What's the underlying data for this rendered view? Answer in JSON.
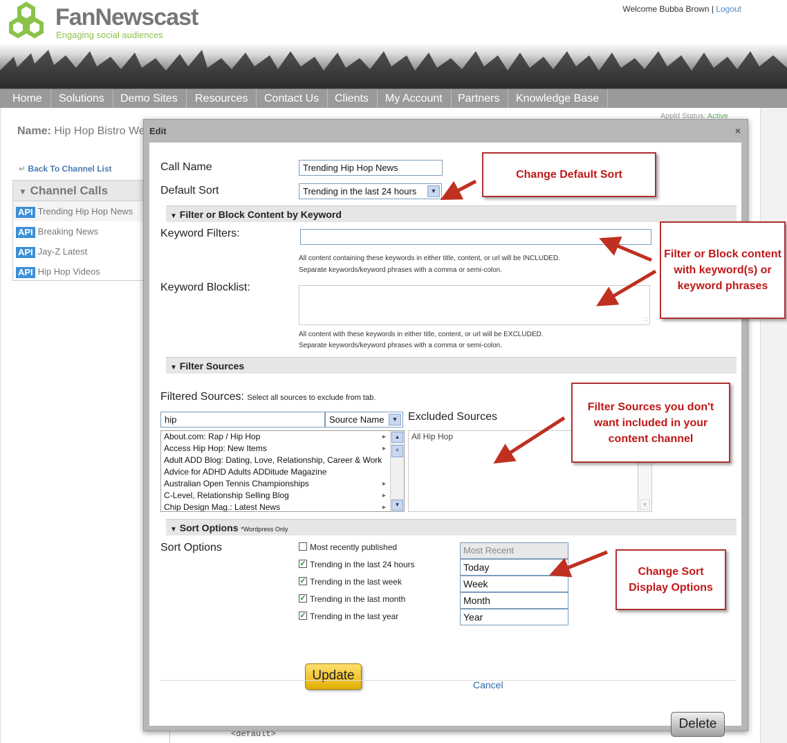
{
  "brand": {
    "name": "FanNewscast",
    "tagline": "Engaging social audiences"
  },
  "user": {
    "welcome": "Welcome Bubba Brown |",
    "logout": "Logout"
  },
  "nav": [
    "Home",
    "Solutions",
    "Demo Sites",
    "Resources",
    "Contact Us",
    "Clients",
    "My Account",
    "Partners",
    "Knowledge Base"
  ],
  "page": {
    "name_label": "Name:",
    "name_value": "Hip Hop Bistro We",
    "back_link": "Back To Channel List",
    "status_label": "Appld Status:",
    "status_value": "Active",
    "code_line": "<default>"
  },
  "channel_calls": {
    "title": "Channel Calls",
    "badge": "API",
    "items": [
      "Trending Hip Hop News",
      "Breaking News",
      "Jay-Z Latest",
      "Hip Hop Videos"
    ]
  },
  "dialog": {
    "title": "Edit",
    "close": "×",
    "call_name_label": "Call Name",
    "call_name_value": "Trending Hip Hop News",
    "default_sort_label": "Default Sort",
    "default_sort_value": "Trending in the last 24 hours",
    "section_keyword": "Filter or Block Content by Keyword",
    "keyword_filters_label": "Keyword Filters:",
    "keyword_filters_value": "",
    "keyword_filters_hint1": "All content containing these keywords in either title, content, or url will be INCLUDED.",
    "keyword_filters_hint2": "Separate keywords/keyword phrases with a comma or semi-colon.",
    "keyword_blocklist_label": "Keyword Blocklist:",
    "keyword_blocklist_hint1": "All content with these keywords in either title, content, or url will be EXCLUDED.",
    "keyword_blocklist_hint2": "Separate keywords/keyword phrases with a comma or semi-colon.",
    "section_sources": "Filter Sources",
    "filtered_sources_label": "Filtered Sources:",
    "filtered_sources_hint": "Select all sources to exclude from tab.",
    "source_search_value": "hip",
    "source_type_value": "Source Name",
    "excluded_sources_label": "Excluded Sources",
    "sources": [
      "About.com: Rap / Hip Hop",
      "Access Hip Hop: New Items",
      "Adult ADD Blog: Dating, Love, Relationship, Career & Work",
      "Advice for ADHD Adults ADDitude Magazine",
      "Australian Open Tennis Championships",
      "C-Level, Relationship Selling Blog",
      "Chip Design Mag.: Latest News"
    ],
    "excluded": [
      "All Hip Hop"
    ],
    "section_sort": "Sort Options",
    "section_sort_note": "*Wordpress Only",
    "sort_options_label": "Sort Options",
    "sort_options": [
      {
        "label": "Most recently published",
        "checked": false,
        "display": "Most Recent"
      },
      {
        "label": "Trending in the last 24 hours",
        "checked": true,
        "display": "Today"
      },
      {
        "label": "Trending in the last week",
        "checked": true,
        "display": "Week"
      },
      {
        "label": "Trending in the last month",
        "checked": true,
        "display": "Month"
      },
      {
        "label": "Trending in the last year",
        "checked": true,
        "display": "Year"
      }
    ],
    "update_label": "Update",
    "cancel_label": "Cancel",
    "delete_label": "Delete"
  },
  "callouts": {
    "default_sort": "Change Default Sort",
    "keyword": "Filter or Block content with keyword(s) or keyword phrases",
    "sources": "Filter Sources you don't want included in your content channel",
    "sort_display": "Change Sort Display Options"
  },
  "colors": {
    "accent_red": "#c01818",
    "brand_green": "#8bc34a",
    "nav_gray": "#9a9a9a",
    "update_yellow": "#f0c020"
  }
}
